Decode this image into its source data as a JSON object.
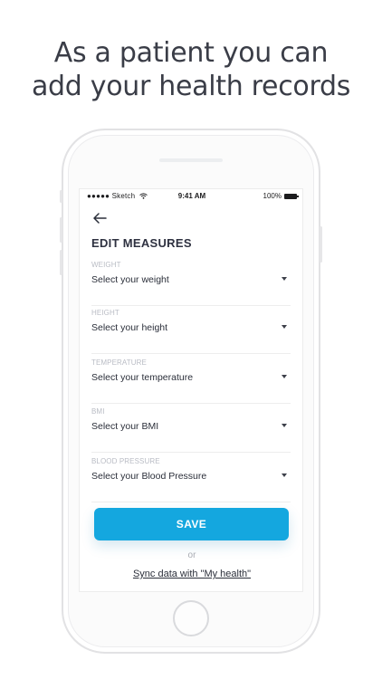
{
  "headline": {
    "line1": "As a patient you can",
    "line2": "add your health records"
  },
  "status_bar": {
    "carrier": "●●●●● Sketch",
    "time": "9:41 AM",
    "battery": "100%"
  },
  "screen": {
    "title": "EDIT MEASURES",
    "fields": [
      {
        "label": "WEIGHT",
        "value": "Select your weight"
      },
      {
        "label": "HEIGHT",
        "value": "Select your height"
      },
      {
        "label": "TEMPERATURE",
        "value": "Select your temperature"
      },
      {
        "label": "BMI",
        "value": "Select your BMI"
      },
      {
        "label": "BLOOD PRESSURE",
        "value": "Select your Blood Pressure"
      }
    ],
    "save_label": "SAVE",
    "or_label": "or",
    "sync_label": "Sync data with \"My health\""
  },
  "icons": {
    "back": "back-arrow-icon",
    "dropdown": "caret-down-icon",
    "wifi": "wifi-icon",
    "battery": "battery-icon"
  },
  "colors": {
    "accent": "#14a7df",
    "text": "#2b2f3a",
    "label": "#b9bcc4"
  }
}
